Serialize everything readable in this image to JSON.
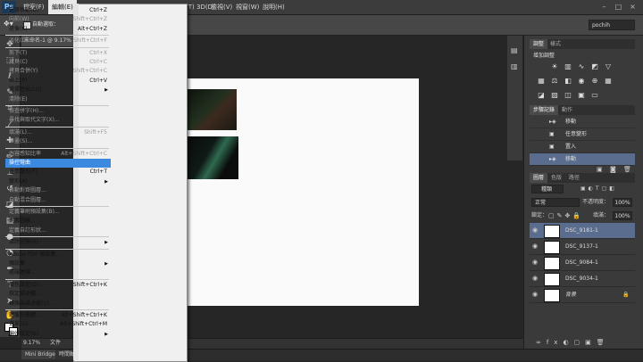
{
  "app": {
    "logo": "Ps"
  },
  "menubar": {
    "items": [
      "檔案(F)",
      "編輯(E)",
      "影像(I)",
      "圖層(L)",
      "文字(Y)",
      "選取(S)",
      "濾鏡(T)",
      "3D(D)",
      "檢視(V)",
      "視窗(W)",
      "說明(H)"
    ],
    "window_controls": [
      "–",
      "□",
      "×"
    ]
  },
  "options": {
    "auto_select_label": "自動選取：",
    "user": "pochih"
  },
  "document": {
    "tab": "未命名-1 @ 9.17%",
    "zoom": "9.17%"
  },
  "status": {
    "zoom": "9.17%",
    "label": "文件"
  },
  "bottom_tabs": [
    "Mini Bridge",
    "時間軸"
  ],
  "edit_menu": [
    {
      "label": "還原移動(O)",
      "shortcut": "Ctrl+Z",
      "disabled": false
    },
    {
      "label": "向前(W)",
      "shortcut": "Shift+Ctrl+Z",
      "disabled": true
    },
    {
      "label": "退後(K)",
      "shortcut": "Alt+Ctrl+Z",
      "disabled": false
    },
    {
      "sep": true
    },
    {
      "label": "淡化(D)...",
      "shortcut": "Shift+Ctrl+F",
      "disabled": true
    },
    {
      "sep": true
    },
    {
      "label": "剪下(T)",
      "shortcut": "Ctrl+X",
      "disabled": true
    },
    {
      "label": "拷貝(C)",
      "shortcut": "Ctrl+C",
      "disabled": true
    },
    {
      "label": "拷貝合併(Y)",
      "shortcut": "Shift+Ctrl+C",
      "disabled": true
    },
    {
      "label": "貼上(P)",
      "shortcut": "Ctrl+V",
      "disabled": false
    },
    {
      "label": "選擇性貼上(I)",
      "shortcut": "",
      "disabled": false,
      "submenu": true
    },
    {
      "label": "清除(E)",
      "shortcut": "",
      "disabled": true
    },
    {
      "sep": true
    },
    {
      "label": "檢查拼字(H)...",
      "shortcut": "",
      "disabled": true
    },
    {
      "label": "尋找與取代文字(X)...",
      "shortcut": "",
      "disabled": true
    },
    {
      "sep": true
    },
    {
      "label": "填滿(L)...",
      "shortcut": "Shift+F5",
      "disabled": true
    },
    {
      "label": "筆畫(S)...",
      "shortcut": "",
      "disabled": true
    },
    {
      "sep": true
    },
    {
      "label": "內容感知比率",
      "shortcut": "Alt+Shift+Ctrl+C",
      "disabled": true
    },
    {
      "label": "操控彎曲",
      "shortcut": "",
      "disabled": false,
      "highlight": true
    },
    {
      "label": "任意變形(F)",
      "shortcut": "Ctrl+T",
      "disabled": false
    },
    {
      "label": "變形(A)",
      "shortcut": "",
      "disabled": false,
      "submenu": true
    },
    {
      "label": "自動對齊圖層...",
      "shortcut": "",
      "disabled": true
    },
    {
      "label": "自動混合圖層...",
      "shortcut": "",
      "disabled": true
    },
    {
      "sep": true
    },
    {
      "label": "定義筆刷預設集(B)...",
      "shortcut": "",
      "disabled": true
    },
    {
      "label": "定義圖樣...",
      "shortcut": "",
      "disabled": false
    },
    {
      "label": "定義自訂形狀...",
      "shortcut": "",
      "disabled": true
    },
    {
      "sep": true
    },
    {
      "label": "清除記憶(R)",
      "shortcut": "",
      "disabled": false,
      "submenu": true
    },
    {
      "sep": true
    },
    {
      "label": "Adobe PDF 預設集...",
      "shortcut": "",
      "disabled": false
    },
    {
      "label": "預設集",
      "shortcut": "",
      "disabled": false,
      "submenu": true
    },
    {
      "label": "遠端連線...",
      "shortcut": "",
      "disabled": false
    },
    {
      "sep": true
    },
    {
      "label": "顏色設定(G)...",
      "shortcut": "Shift+Ctrl+K",
      "disabled": false
    },
    {
      "label": "指定描述檔...",
      "shortcut": "",
      "disabled": false
    },
    {
      "label": "轉換為描述檔(V)...",
      "shortcut": "",
      "disabled": false
    },
    {
      "sep": true
    },
    {
      "label": "鍵盤快速鍵...",
      "shortcut": "Alt+Shift+Ctrl+K",
      "disabled": false
    },
    {
      "label": "選單(U)...",
      "shortcut": "Alt+Shift+Ctrl+M",
      "disabled": false
    },
    {
      "label": "偏好設定(N)",
      "shortcut": "",
      "disabled": false,
      "submenu": true
    }
  ],
  "adjust_panel": {
    "tabs": [
      "調整",
      "樣式"
    ],
    "title": "增加調整"
  },
  "history_panel": {
    "tabs": [
      "步驟記錄",
      "動作"
    ],
    "rows": [
      {
        "label": "移動",
        "selected": false
      },
      {
        "label": "任意變形",
        "selected": false
      },
      {
        "label": "置入",
        "selected": false
      },
      {
        "label": "移動",
        "selected": true
      }
    ]
  },
  "layers_panel": {
    "tabs": [
      "圖層",
      "色版",
      "路徑"
    ],
    "kind": "種類",
    "blend_mode": "正常",
    "opacity_label": "不透明度：",
    "opacity": "100%",
    "lock_label": "鎖定：",
    "fill_label": "填滿：",
    "fill": "100%",
    "layers": [
      {
        "name": "DSC_9181-1",
        "selected": true
      },
      {
        "name": "DSC_9137-1",
        "selected": false
      },
      {
        "name": "DSC_9084-1",
        "selected": false
      },
      {
        "name": "DSC_9034-1",
        "selected": false
      },
      {
        "name": "背景",
        "selected": false
      }
    ]
  }
}
